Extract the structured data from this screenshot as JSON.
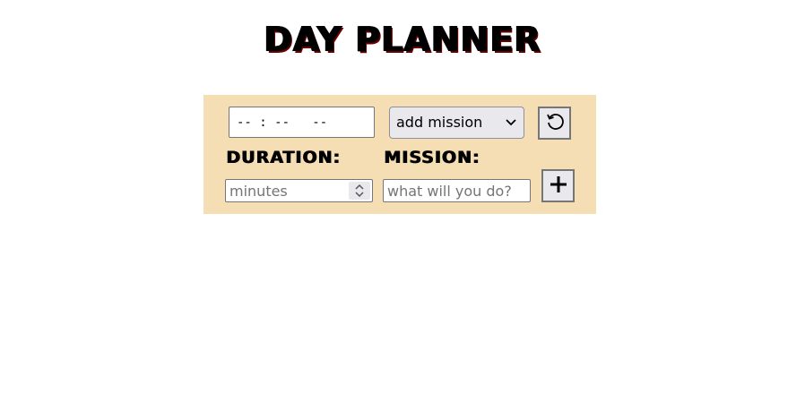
{
  "title": "DAY PLANNER",
  "form": {
    "time_placeholder": "-- : --   --",
    "mission_select": {
      "selected": "add mission",
      "icon": "chevron-down-icon"
    },
    "reset_icon": "reset-icon",
    "duration_label": "DURATION:",
    "duration_placeholder": "minutes",
    "mission_label": "MISSION:",
    "mission_placeholder": "what will you do?",
    "add_icon": "plus-icon"
  },
  "colors": {
    "panel_background": "#f5deb3",
    "button_background": "#e9e9ed"
  }
}
